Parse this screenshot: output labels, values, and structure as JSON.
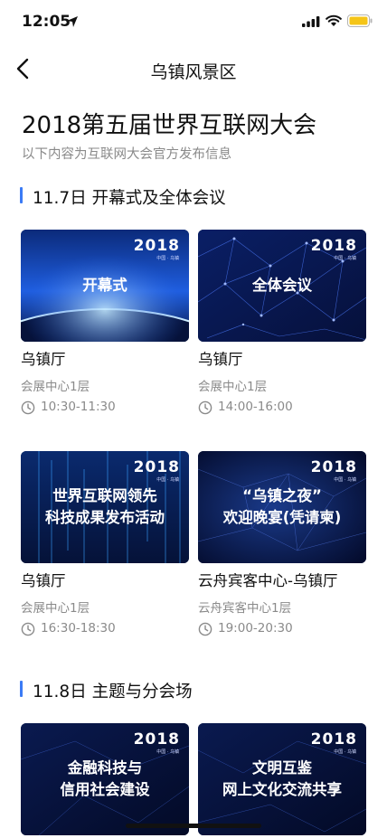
{
  "status": {
    "time": "12:05"
  },
  "nav": {
    "title": "乌镇风景区"
  },
  "page": {
    "title": "2018第五届世界互联网大会",
    "subtitle": "以下内容为互联网大会官方发布信息"
  },
  "sections": [
    {
      "label": "11.7日 开幕式及全体会议"
    },
    {
      "label": "11.8日 主题与分会场"
    }
  ],
  "logo": {
    "text": "2018",
    "sub": "中国 · 乌镇"
  },
  "cards": [
    {
      "title": [
        "开幕式"
      ],
      "venue": "乌镇厅",
      "place": "会展中心1层",
      "time": "10:30-11:30"
    },
    {
      "title": [
        "全体会议"
      ],
      "venue": "乌镇厅",
      "place": "会展中心1层",
      "time": "14:00-16:00"
    },
    {
      "title": [
        "世界互联网领先",
        "科技成果发布活动"
      ],
      "venue": "乌镇厅",
      "place": "会展中心1层",
      "time": "16:30-18:30"
    },
    {
      "title": [
        "“乌镇之夜”",
        "欢迎晚宴(凭请柬)"
      ],
      "venue": "云舟宾客中心-乌镇厅",
      "place": "云舟宾客中心1层",
      "time": "19:00-20:30"
    },
    {
      "title": [
        "金融科技与",
        "信用社会建设"
      ]
    },
    {
      "title": [
        "文明互鉴",
        "网上文化交流共享"
      ]
    }
  ],
  "icons": [
    "location-arrow-icon",
    "signal-icon",
    "wifi-icon",
    "battery-icon",
    "back-chevron-icon",
    "clock-icon"
  ],
  "colors": {
    "accent": "#3b7bf5",
    "battery": "#f5c518",
    "muted": "#8a8a8a"
  }
}
